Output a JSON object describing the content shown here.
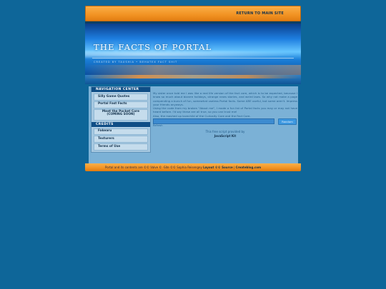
{
  "header": {
    "return_link": "RETURN TO MAIN SITE"
  },
  "banner": {
    "title": "THE FACTS OF PORTAL",
    "subtitle": "CREATED BY TAUSHIA • BEHATEX FACT SHIT"
  },
  "sidebar": {
    "nav_header": "NAVIGATION CENTER",
    "nav_items": [
      {
        "label": "Silly Game Quotes"
      },
      {
        "label": "Portal Fast Facts"
      },
      {
        "label": "Meet the Pocket Core (COMING SOON)"
      }
    ],
    "credits_header": "CREDITS",
    "credit_items": [
      {
        "label": "Fakearu"
      },
      {
        "label": "Texturers"
      },
      {
        "label": "Terms of Use"
      }
    ]
  },
  "main": {
    "intro_lines": [
      "My sister once told me I was like a real life version of the fact core, which is to be expected, because I know so much about bizarre holidays, strange news stories, and weird laws. So why not make a page compending a bunch of fun, somewhat useless Portal facts. Some ARE useful, but some aren't. Impress your friends anyways.",
      "Using the code from my broken \"About me\", I made a fun list of Portal facts you may or may not have heard before. I'd say these are all true, so you can trust me!",
      "Also, the mashed up lovechild of the Curiosity Core and the Fact Core."
    ],
    "fact_value": "",
    "random_button": "Random",
    "small_link": "Refresh",
    "credit_line_1": "This free script provided by",
    "credit_line_2": "JavaScript Kit"
  },
  "footer": {
    "text": "Portal and its contents are ©© Valve © -Site ©© Sophia Reisengey",
    "layout_label": "Layout ©© Source",
    "separator": "|",
    "createblog": "Createblog.com"
  }
}
